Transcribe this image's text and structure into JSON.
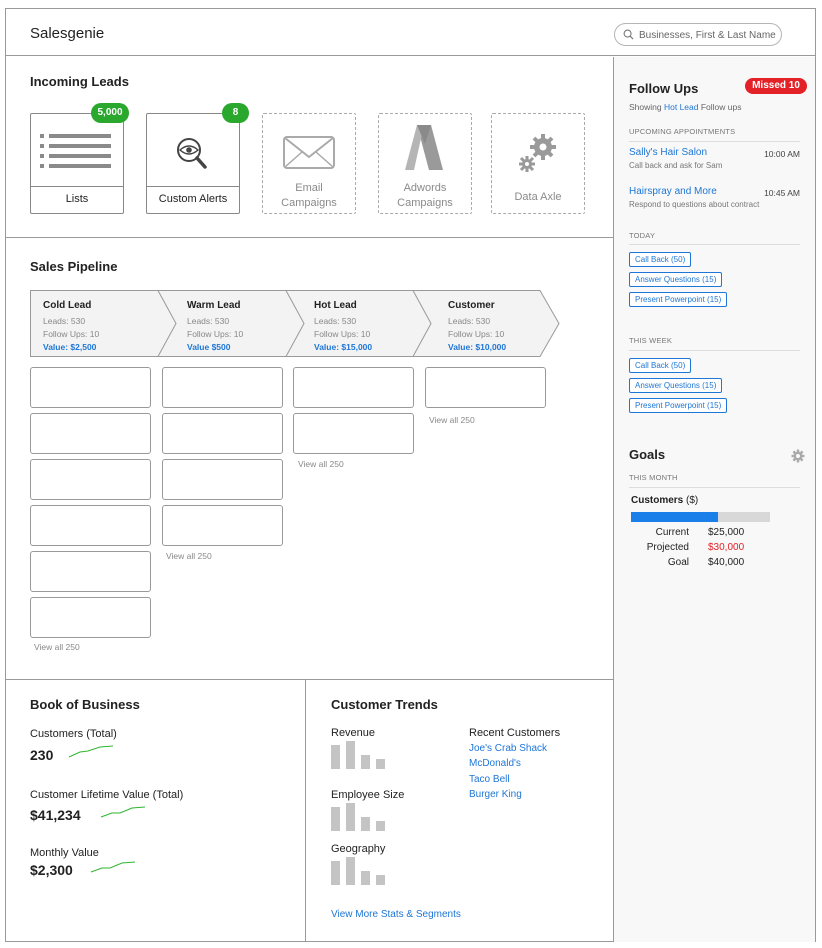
{
  "app": {
    "title": "Salesgenie"
  },
  "search": {
    "placeholder": "Businesses, First & Last Name"
  },
  "incoming_leads": {
    "title": "Incoming Leads",
    "tiles": [
      {
        "label": "Lists",
        "badge": "5,000",
        "icon": "list-icon"
      },
      {
        "label": "Custom Alerts",
        "badge": "8",
        "icon": "eye-magnifier-icon"
      },
      {
        "label_line1": "Email",
        "label_line2": "Campaigns",
        "icon": "envelope-icon"
      },
      {
        "label_line1": "Adwords",
        "label_line2": "Campaigns",
        "icon": "adwords-icon"
      },
      {
        "label": "Data Axle",
        "icon": "gears-icon"
      }
    ]
  },
  "pipeline": {
    "title": "Sales Pipeline",
    "stages": [
      {
        "name": "Cold Lead",
        "leads": "Leads: 530",
        "followups": "Follow Ups: 10",
        "value": "Value: $2,500",
        "view_all": "View all 250"
      },
      {
        "name": "Warm Lead",
        "leads": "Leads: 530",
        "followups": "Follow Ups: 10",
        "value": "Value $500",
        "view_all": "View all 250"
      },
      {
        "name": "Hot Lead",
        "leads": "Leads: 530",
        "followups": "Follow Ups: 10",
        "value": "Value: $15,000",
        "view_all": "View all 250"
      },
      {
        "name": "Customer",
        "leads": "Leads: 530",
        "followups": "Follow Ups: 10",
        "value": "Value: $10,000",
        "view_all": "View all 250"
      }
    ]
  },
  "book": {
    "title": "Book of Business",
    "metrics": [
      {
        "label": "Customers (Total)",
        "value": "230"
      },
      {
        "label": "Customer Lifetime Value (Total)",
        "value": "$41,234"
      },
      {
        "label": "Monthly Value",
        "value": "$2,300"
      }
    ]
  },
  "trends": {
    "title": "Customer Trends",
    "groups": [
      "Revenue",
      "Employee Size",
      "Geography"
    ],
    "recent_title": "Recent Customers",
    "recent": [
      "Joe's Crab Shack",
      "McDonald's",
      "Taco Bell",
      "Burger King"
    ],
    "more_link": "View More Stats & Segments"
  },
  "follow_ups": {
    "title": "Follow Ups",
    "missed": "Missed 10",
    "showing_prefix": "Showing",
    "showing_link": "Hot Lead",
    "showing_suffix": "Follow ups",
    "upcoming_label": "UPCOMING APPOINTMENTS",
    "appointments": [
      {
        "name": "Sally's Hair Salon",
        "time": "10:00 AM",
        "note": "Call back and ask for Sam"
      },
      {
        "name": "Hairspray and More",
        "time": "10:45 AM",
        "note": "Respond to questions about contract"
      }
    ],
    "today_label": "TODAY",
    "today": [
      "Call Back (50)",
      "Answer Questions (15)",
      "Present Powerpoint (15)"
    ],
    "week_label": "THIS WEEK",
    "week": [
      "Call Back (50)",
      "Answer Questions (15)",
      "Present Powerpoint (15)"
    ]
  },
  "goals": {
    "title": "Goals",
    "period": "THIS MONTH",
    "category": "Customers",
    "category_unit": "($)",
    "progress_fraction": 0.625,
    "rows": [
      {
        "label": "Current",
        "value": "$25,000"
      },
      {
        "label": "Projected",
        "value": "$30,000"
      },
      {
        "label": "Goal",
        "value": "$40,000"
      }
    ]
  },
  "colors": {
    "accent": "#1e76d6",
    "badge_green": "#2aa72d",
    "alert_red": "#e32127",
    "goal_fill": "#1a7fe8"
  }
}
